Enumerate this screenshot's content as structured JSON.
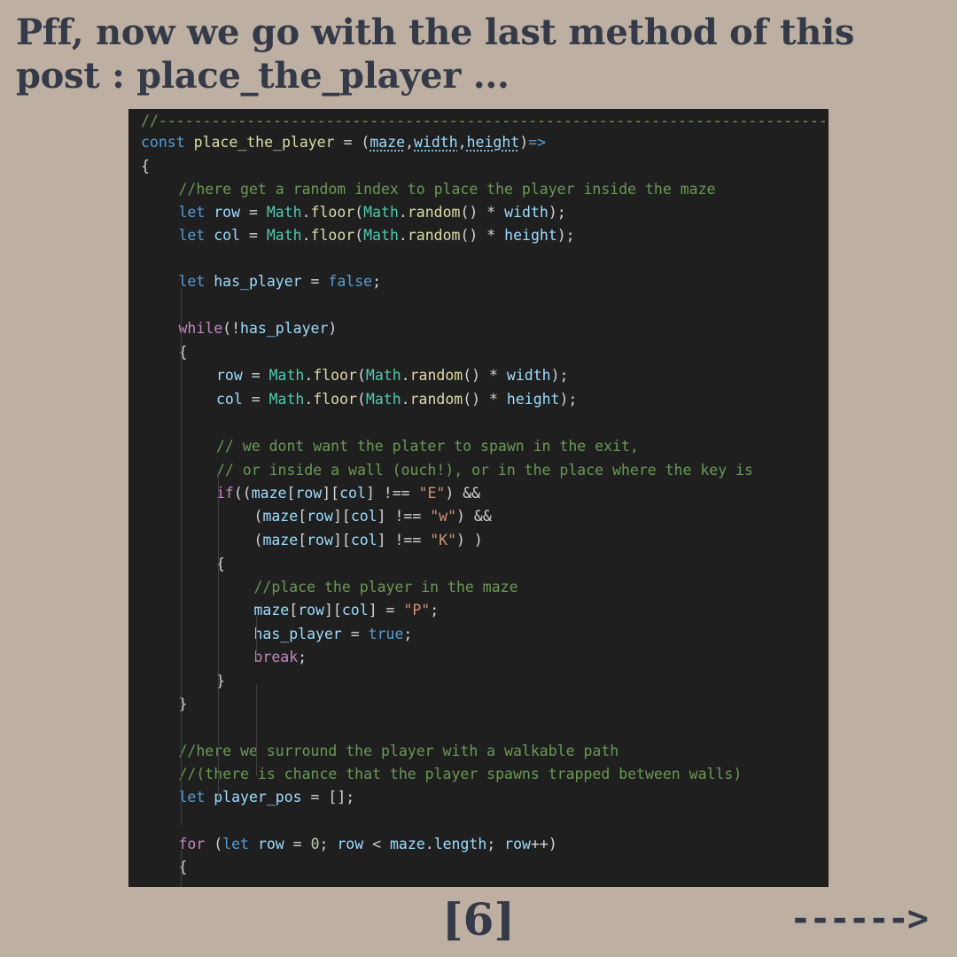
{
  "post": {
    "heading": "Pff, now we go with the last method of this post : place_the_player ...",
    "page_number": "[6]",
    "next_arrow": "------>"
  },
  "editor": {
    "theme": {
      "background": "#1f1f1f",
      "comment": "#6a9955",
      "keyword": "#569cd6",
      "control": "#c586c0",
      "variable": "#9cdcfe",
      "function": "#dcdcaa",
      "class": "#4ec9b0",
      "string": "#ce9178",
      "number": "#b5cea8"
    },
    "lines": [
      {
        "indent": 0,
        "tokens": [
          {
            "t": "com",
            "v": "//---------------------------------------------------------------------------------------------"
          }
        ]
      },
      {
        "indent": 0,
        "tokens": [
          {
            "t": "kw",
            "v": "const"
          },
          {
            "t": "op",
            "v": " "
          },
          {
            "t": "fn",
            "v": "place_the_player"
          },
          {
            "t": "op",
            "v": " = ("
          },
          {
            "t": "var dot",
            "v": "maze"
          },
          {
            "t": "pun",
            "v": ","
          },
          {
            "t": "var dot",
            "v": "width"
          },
          {
            "t": "pun",
            "v": ","
          },
          {
            "t": "var dot",
            "v": "height"
          },
          {
            "t": "pun",
            "v": ")"
          },
          {
            "t": "kw",
            "v": "=>"
          }
        ]
      },
      {
        "indent": 0,
        "tokens": [
          {
            "t": "pun",
            "v": "{"
          }
        ]
      },
      {
        "indent": 1,
        "tokens": [
          {
            "t": "com",
            "v": "//here get a random index to place the player inside the maze"
          }
        ]
      },
      {
        "indent": 1,
        "tokens": [
          {
            "t": "kw",
            "v": "let"
          },
          {
            "t": "op",
            "v": " "
          },
          {
            "t": "var",
            "v": "row"
          },
          {
            "t": "op",
            "v": " = "
          },
          {
            "t": "cls",
            "v": "Math"
          },
          {
            "t": "pun",
            "v": "."
          },
          {
            "t": "fn",
            "v": "floor"
          },
          {
            "t": "pun",
            "v": "("
          },
          {
            "t": "cls",
            "v": "Math"
          },
          {
            "t": "pun",
            "v": "."
          },
          {
            "t": "fn",
            "v": "random"
          },
          {
            "t": "pun",
            "v": "() * "
          },
          {
            "t": "var",
            "v": "width"
          },
          {
            "t": "pun",
            "v": ");"
          }
        ]
      },
      {
        "indent": 1,
        "tokens": [
          {
            "t": "kw",
            "v": "let"
          },
          {
            "t": "op",
            "v": " "
          },
          {
            "t": "var",
            "v": "col"
          },
          {
            "t": "op",
            "v": " = "
          },
          {
            "t": "cls",
            "v": "Math"
          },
          {
            "t": "pun",
            "v": "."
          },
          {
            "t": "fn",
            "v": "floor"
          },
          {
            "t": "pun",
            "v": "("
          },
          {
            "t": "cls",
            "v": "Math"
          },
          {
            "t": "pun",
            "v": "."
          },
          {
            "t": "fn",
            "v": "random"
          },
          {
            "t": "pun",
            "v": "() * "
          },
          {
            "t": "var",
            "v": "height"
          },
          {
            "t": "pun",
            "v": ");"
          }
        ]
      },
      {
        "indent": 0,
        "tokens": []
      },
      {
        "indent": 1,
        "tokens": [
          {
            "t": "kw",
            "v": "let"
          },
          {
            "t": "op",
            "v": " "
          },
          {
            "t": "var",
            "v": "has_player"
          },
          {
            "t": "op",
            "v": " = "
          },
          {
            "t": "kw",
            "v": "false"
          },
          {
            "t": "pun",
            "v": ";"
          }
        ]
      },
      {
        "indent": 0,
        "tokens": []
      },
      {
        "indent": 1,
        "tokens": [
          {
            "t": "ctl",
            "v": "while"
          },
          {
            "t": "pun",
            "v": "(!"
          },
          {
            "t": "var",
            "v": "has_player"
          },
          {
            "t": "pun",
            "v": ")"
          }
        ]
      },
      {
        "indent": 1,
        "tokens": [
          {
            "t": "pun",
            "v": "{"
          }
        ]
      },
      {
        "indent": 2,
        "tokens": [
          {
            "t": "var",
            "v": "row"
          },
          {
            "t": "op",
            "v": " = "
          },
          {
            "t": "cls",
            "v": "Math"
          },
          {
            "t": "pun",
            "v": "."
          },
          {
            "t": "fn",
            "v": "floor"
          },
          {
            "t": "pun",
            "v": "("
          },
          {
            "t": "cls",
            "v": "Math"
          },
          {
            "t": "pun",
            "v": "."
          },
          {
            "t": "fn",
            "v": "random"
          },
          {
            "t": "pun",
            "v": "() * "
          },
          {
            "t": "var",
            "v": "width"
          },
          {
            "t": "pun",
            "v": ");"
          }
        ]
      },
      {
        "indent": 2,
        "tokens": [
          {
            "t": "var",
            "v": "col"
          },
          {
            "t": "op",
            "v": " = "
          },
          {
            "t": "cls",
            "v": "Math"
          },
          {
            "t": "pun",
            "v": "."
          },
          {
            "t": "fn",
            "v": "floor"
          },
          {
            "t": "pun",
            "v": "("
          },
          {
            "t": "cls",
            "v": "Math"
          },
          {
            "t": "pun",
            "v": "."
          },
          {
            "t": "fn",
            "v": "random"
          },
          {
            "t": "pun",
            "v": "() * "
          },
          {
            "t": "var",
            "v": "height"
          },
          {
            "t": "pun",
            "v": ");"
          }
        ]
      },
      {
        "indent": 0,
        "tokens": []
      },
      {
        "indent": 2,
        "tokens": [
          {
            "t": "com",
            "v": "// we dont want the plater to spawn in the exit,"
          }
        ]
      },
      {
        "indent": 2,
        "tokens": [
          {
            "t": "com",
            "v": "// or inside a wall (ouch!), or in the place where the key is"
          }
        ]
      },
      {
        "indent": 2,
        "tokens": [
          {
            "t": "ctl",
            "v": "if"
          },
          {
            "t": "pun",
            "v": "(("
          },
          {
            "t": "var",
            "v": "maze"
          },
          {
            "t": "pun",
            "v": "["
          },
          {
            "t": "var",
            "v": "row"
          },
          {
            "t": "pun",
            "v": "]["
          },
          {
            "t": "var",
            "v": "col"
          },
          {
            "t": "pun",
            "v": "] !== "
          },
          {
            "t": "str",
            "v": "\"E\""
          },
          {
            "t": "pun",
            "v": ") &&"
          }
        ]
      },
      {
        "indent": 3,
        "tokens": [
          {
            "t": "pun",
            "v": "("
          },
          {
            "t": "var",
            "v": "maze"
          },
          {
            "t": "pun",
            "v": "["
          },
          {
            "t": "var",
            "v": "row"
          },
          {
            "t": "pun",
            "v": "]["
          },
          {
            "t": "var",
            "v": "col"
          },
          {
            "t": "pun",
            "v": "] !== "
          },
          {
            "t": "str",
            "v": "\"w\""
          },
          {
            "t": "pun",
            "v": ") &&"
          }
        ]
      },
      {
        "indent": 3,
        "tokens": [
          {
            "t": "pun",
            "v": "("
          },
          {
            "t": "var",
            "v": "maze"
          },
          {
            "t": "pun",
            "v": "["
          },
          {
            "t": "var",
            "v": "row"
          },
          {
            "t": "pun",
            "v": "]["
          },
          {
            "t": "var",
            "v": "col"
          },
          {
            "t": "pun",
            "v": "] !== "
          },
          {
            "t": "str",
            "v": "\"K\""
          },
          {
            "t": "pun",
            "v": ") )"
          }
        ]
      },
      {
        "indent": 2,
        "tokens": [
          {
            "t": "pun",
            "v": "{"
          }
        ]
      },
      {
        "indent": 3,
        "tokens": [
          {
            "t": "com",
            "v": "//place the player in the maze"
          }
        ]
      },
      {
        "indent": 3,
        "tokens": [
          {
            "t": "var",
            "v": "maze"
          },
          {
            "t": "pun",
            "v": "["
          },
          {
            "t": "var",
            "v": "row"
          },
          {
            "t": "pun",
            "v": "]["
          },
          {
            "t": "var",
            "v": "col"
          },
          {
            "t": "pun",
            "v": "] = "
          },
          {
            "t": "str",
            "v": "\"P\""
          },
          {
            "t": "pun",
            "v": ";"
          }
        ]
      },
      {
        "indent": 3,
        "tokens": [
          {
            "t": "var",
            "v": "has_player"
          },
          {
            "t": "op",
            "v": " = "
          },
          {
            "t": "kw",
            "v": "true"
          },
          {
            "t": "pun",
            "v": ";"
          }
        ]
      },
      {
        "indent": 3,
        "tokens": [
          {
            "t": "ctl",
            "v": "break"
          },
          {
            "t": "pun",
            "v": ";"
          }
        ]
      },
      {
        "indent": 2,
        "tokens": [
          {
            "t": "pun",
            "v": "}"
          }
        ]
      },
      {
        "indent": 1,
        "tokens": [
          {
            "t": "pun",
            "v": "}"
          }
        ]
      },
      {
        "indent": 0,
        "tokens": []
      },
      {
        "indent": 1,
        "tokens": [
          {
            "t": "com",
            "v": "//here we surround the player with a walkable path"
          }
        ]
      },
      {
        "indent": 1,
        "tokens": [
          {
            "t": "com",
            "v": "//(there is chance that the player spawns trapped between walls)"
          }
        ]
      },
      {
        "indent": 1,
        "tokens": [
          {
            "t": "kw",
            "v": "let"
          },
          {
            "t": "op",
            "v": " "
          },
          {
            "t": "var",
            "v": "player_pos"
          },
          {
            "t": "op",
            "v": " = "
          },
          {
            "t": "pun",
            "v": "[];"
          }
        ]
      },
      {
        "indent": 0,
        "tokens": []
      },
      {
        "indent": 1,
        "tokens": [
          {
            "t": "ctl",
            "v": "for"
          },
          {
            "t": "pun",
            "v": " ("
          },
          {
            "t": "kw",
            "v": "let"
          },
          {
            "t": "op",
            "v": " "
          },
          {
            "t": "var",
            "v": "row"
          },
          {
            "t": "op",
            "v": " = "
          },
          {
            "t": "num",
            "v": "0"
          },
          {
            "t": "pun",
            "v": "; "
          },
          {
            "t": "var",
            "v": "row"
          },
          {
            "t": "op",
            "v": " < "
          },
          {
            "t": "var",
            "v": "maze"
          },
          {
            "t": "pun",
            "v": "."
          },
          {
            "t": "var",
            "v": "length"
          },
          {
            "t": "pun",
            "v": "; "
          },
          {
            "t": "var",
            "v": "row"
          },
          {
            "t": "op",
            "v": "++"
          },
          {
            "t": "pun",
            "v": ")"
          }
        ]
      },
      {
        "indent": 1,
        "tokens": [
          {
            "t": "pun",
            "v": "{"
          }
        ]
      }
    ]
  }
}
